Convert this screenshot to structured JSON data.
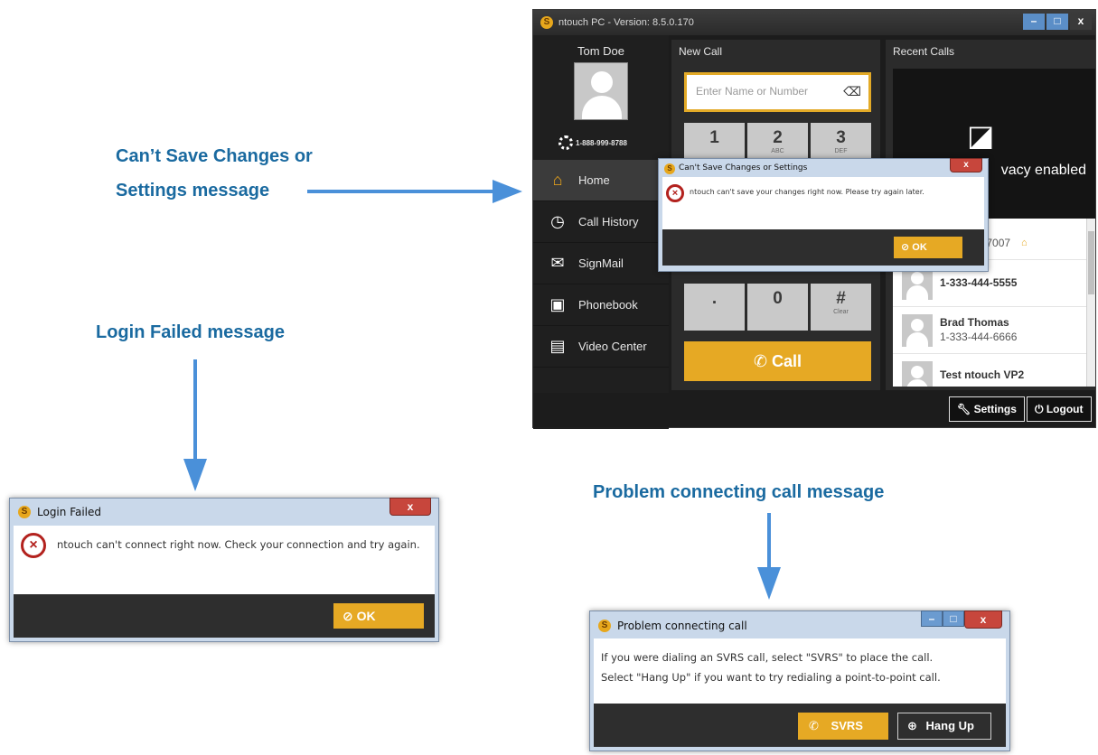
{
  "callouts": {
    "cant_save_line1": "Can’t Save Changes or",
    "cant_save_line2": "Settings message",
    "login_failed": "Login Failed message",
    "problem_connecting": "Problem connecting call message"
  },
  "app": {
    "title": "ntouch PC - Version: 8.5.0.170",
    "user": {
      "name": "Tom Doe",
      "phone": "1-888-999-8788"
    },
    "nav": [
      {
        "label": "Home",
        "icon": "home-icon"
      },
      {
        "label": "Call History",
        "icon": "call-history-icon"
      },
      {
        "label": "SignMail",
        "icon": "envelope-icon"
      },
      {
        "label": "Phonebook",
        "icon": "phonebook-icon"
      },
      {
        "label": "Video Center",
        "icon": "film-icon"
      }
    ],
    "new_call": {
      "heading": "New Call",
      "search_placeholder": "Enter Name or Number",
      "keys": [
        {
          "digit": "1",
          "sub": ""
        },
        {
          "digit": "2",
          "sub": "ABC"
        },
        {
          "digit": "3",
          "sub": "DEF"
        },
        {
          "digit": ".",
          "sub": ""
        },
        {
          "digit": "0",
          "sub": ""
        },
        {
          "digit": "#",
          "sub": "Clear"
        }
      ],
      "call_label": "Call"
    },
    "recent_calls": {
      "heading": "Recent Calls",
      "privacy_text": "vacy enabled",
      "privacy_prefix": "V",
      "entries": [
        {
          "name": "oe",
          "number": "55-7007"
        },
        {
          "name": "",
          "number": "1-333-444-5555"
        },
        {
          "name": "Brad Thomas",
          "number": "1-333-444-6666"
        },
        {
          "name": "Test ntouch VP2",
          "number": ""
        }
      ]
    },
    "footer": {
      "settings_label": "Settings",
      "logout_label": "Logout"
    }
  },
  "dialogs": {
    "cant_save": {
      "title": "Can't Save Changes or Settings",
      "message": "ntouch can't save your changes right now. Please try again later.",
      "ok_label": "OK"
    },
    "login_failed": {
      "title": "Login Failed",
      "message": "ntouch can't connect right now. Check your connection and try again.",
      "ok_label": "OK"
    },
    "problem_connecting": {
      "title": "Problem connecting call",
      "message_line1": "If you were dialing an SVRS call, select \"SVRS\" to place the call.",
      "message_line2": "Select \"Hang Up\" if you want to try redialing a point-to-point call.",
      "svrs_label": "SVRS",
      "hangup_label": "Hang Up"
    }
  },
  "colors": {
    "callout": "#1a6aa0",
    "accent": "#e6a924",
    "error": "#b3221e"
  }
}
